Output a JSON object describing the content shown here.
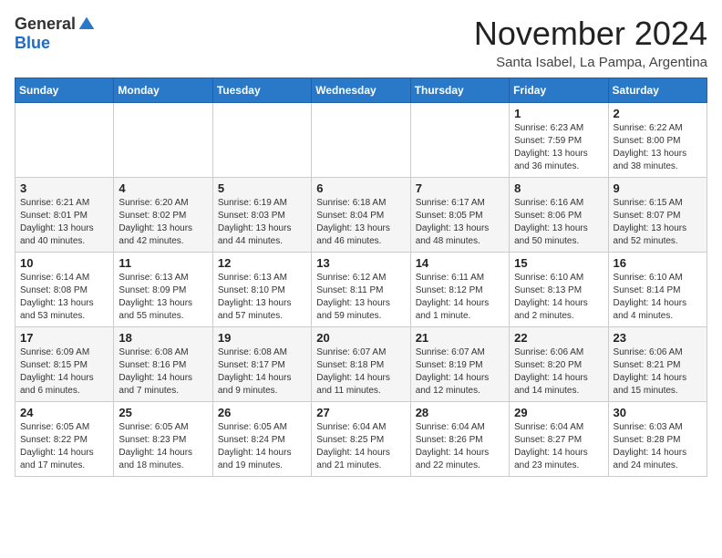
{
  "logo": {
    "general": "General",
    "blue": "Blue"
  },
  "title": {
    "month_year": "November 2024",
    "location": "Santa Isabel, La Pampa, Argentina"
  },
  "weekdays": [
    "Sunday",
    "Monday",
    "Tuesday",
    "Wednesday",
    "Thursday",
    "Friday",
    "Saturday"
  ],
  "weeks": [
    [
      {
        "day": "",
        "info": ""
      },
      {
        "day": "",
        "info": ""
      },
      {
        "day": "",
        "info": ""
      },
      {
        "day": "",
        "info": ""
      },
      {
        "day": "",
        "info": ""
      },
      {
        "day": "1",
        "info": "Sunrise: 6:23 AM\nSunset: 7:59 PM\nDaylight: 13 hours\nand 36 minutes."
      },
      {
        "day": "2",
        "info": "Sunrise: 6:22 AM\nSunset: 8:00 PM\nDaylight: 13 hours\nand 38 minutes."
      }
    ],
    [
      {
        "day": "3",
        "info": "Sunrise: 6:21 AM\nSunset: 8:01 PM\nDaylight: 13 hours\nand 40 minutes."
      },
      {
        "day": "4",
        "info": "Sunrise: 6:20 AM\nSunset: 8:02 PM\nDaylight: 13 hours\nand 42 minutes."
      },
      {
        "day": "5",
        "info": "Sunrise: 6:19 AM\nSunset: 8:03 PM\nDaylight: 13 hours\nand 44 minutes."
      },
      {
        "day": "6",
        "info": "Sunrise: 6:18 AM\nSunset: 8:04 PM\nDaylight: 13 hours\nand 46 minutes."
      },
      {
        "day": "7",
        "info": "Sunrise: 6:17 AM\nSunset: 8:05 PM\nDaylight: 13 hours\nand 48 minutes."
      },
      {
        "day": "8",
        "info": "Sunrise: 6:16 AM\nSunset: 8:06 PM\nDaylight: 13 hours\nand 50 minutes."
      },
      {
        "day": "9",
        "info": "Sunrise: 6:15 AM\nSunset: 8:07 PM\nDaylight: 13 hours\nand 52 minutes."
      }
    ],
    [
      {
        "day": "10",
        "info": "Sunrise: 6:14 AM\nSunset: 8:08 PM\nDaylight: 13 hours\nand 53 minutes."
      },
      {
        "day": "11",
        "info": "Sunrise: 6:13 AM\nSunset: 8:09 PM\nDaylight: 13 hours\nand 55 minutes."
      },
      {
        "day": "12",
        "info": "Sunrise: 6:13 AM\nSunset: 8:10 PM\nDaylight: 13 hours\nand 57 minutes."
      },
      {
        "day": "13",
        "info": "Sunrise: 6:12 AM\nSunset: 8:11 PM\nDaylight: 13 hours\nand 59 minutes."
      },
      {
        "day": "14",
        "info": "Sunrise: 6:11 AM\nSunset: 8:12 PM\nDaylight: 14 hours\nand 1 minute."
      },
      {
        "day": "15",
        "info": "Sunrise: 6:10 AM\nSunset: 8:13 PM\nDaylight: 14 hours\nand 2 minutes."
      },
      {
        "day": "16",
        "info": "Sunrise: 6:10 AM\nSunset: 8:14 PM\nDaylight: 14 hours\nand 4 minutes."
      }
    ],
    [
      {
        "day": "17",
        "info": "Sunrise: 6:09 AM\nSunset: 8:15 PM\nDaylight: 14 hours\nand 6 minutes."
      },
      {
        "day": "18",
        "info": "Sunrise: 6:08 AM\nSunset: 8:16 PM\nDaylight: 14 hours\nand 7 minutes."
      },
      {
        "day": "19",
        "info": "Sunrise: 6:08 AM\nSunset: 8:17 PM\nDaylight: 14 hours\nand 9 minutes."
      },
      {
        "day": "20",
        "info": "Sunrise: 6:07 AM\nSunset: 8:18 PM\nDaylight: 14 hours\nand 11 minutes."
      },
      {
        "day": "21",
        "info": "Sunrise: 6:07 AM\nSunset: 8:19 PM\nDaylight: 14 hours\nand 12 minutes."
      },
      {
        "day": "22",
        "info": "Sunrise: 6:06 AM\nSunset: 8:20 PM\nDaylight: 14 hours\nand 14 minutes."
      },
      {
        "day": "23",
        "info": "Sunrise: 6:06 AM\nSunset: 8:21 PM\nDaylight: 14 hours\nand 15 minutes."
      }
    ],
    [
      {
        "day": "24",
        "info": "Sunrise: 6:05 AM\nSunset: 8:22 PM\nDaylight: 14 hours\nand 17 minutes."
      },
      {
        "day": "25",
        "info": "Sunrise: 6:05 AM\nSunset: 8:23 PM\nDaylight: 14 hours\nand 18 minutes."
      },
      {
        "day": "26",
        "info": "Sunrise: 6:05 AM\nSunset: 8:24 PM\nDaylight: 14 hours\nand 19 minutes."
      },
      {
        "day": "27",
        "info": "Sunrise: 6:04 AM\nSunset: 8:25 PM\nDaylight: 14 hours\nand 21 minutes."
      },
      {
        "day": "28",
        "info": "Sunrise: 6:04 AM\nSunset: 8:26 PM\nDaylight: 14 hours\nand 22 minutes."
      },
      {
        "day": "29",
        "info": "Sunrise: 6:04 AM\nSunset: 8:27 PM\nDaylight: 14 hours\nand 23 minutes."
      },
      {
        "day": "30",
        "info": "Sunrise: 6:03 AM\nSunset: 8:28 PM\nDaylight: 14 hours\nand 24 minutes."
      }
    ]
  ]
}
